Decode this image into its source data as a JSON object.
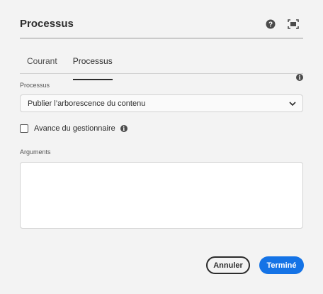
{
  "dialog": {
    "title": "Processus",
    "header_icons": [
      "help-icon",
      "fullscreen-icon"
    ]
  },
  "tabs": [
    {
      "label": "Courant",
      "selected": false
    },
    {
      "label": "Processus",
      "selected": true
    }
  ],
  "form": {
    "processus_label": "Processus",
    "processus_value": "Publier l’arborescence du contenu",
    "checkbox_label": "Avance du gestionnaire",
    "checkbox_checked": false,
    "arguments_label": "Arguments",
    "arguments_value": ""
  },
  "footer": {
    "cancel_label": "Annuler",
    "done_label": "Terminé"
  },
  "colors": {
    "accent": "#1473e6",
    "background": "#f3f3f3"
  }
}
